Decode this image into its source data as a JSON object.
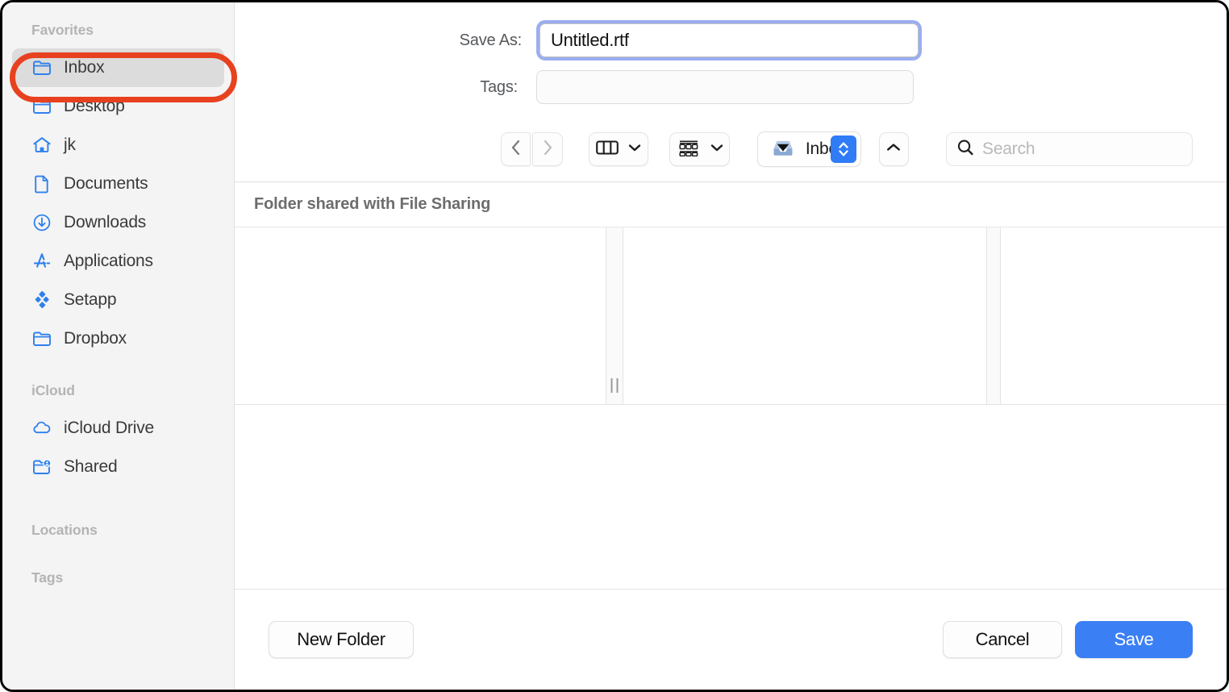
{
  "dialog": {
    "type": "macos-save-dialog"
  },
  "sidebar": {
    "sections": [
      {
        "title": "Favorites"
      },
      {
        "title": "iCloud"
      },
      {
        "title": "Locations"
      },
      {
        "title": "Tags"
      }
    ],
    "favorites": [
      {
        "label": "Inbox",
        "icon": "folder-icon",
        "selected": true
      },
      {
        "label": "Desktop",
        "icon": "folder-icon",
        "selected": false
      },
      {
        "label": "jk",
        "icon": "home-icon",
        "selected": false
      },
      {
        "label": "Documents",
        "icon": "document-icon",
        "selected": false
      },
      {
        "label": "Downloads",
        "icon": "download-icon",
        "selected": false
      },
      {
        "label": "Applications",
        "icon": "app-store-icon",
        "selected": false
      },
      {
        "label": "Setapp",
        "icon": "setapp-icon",
        "selected": false
      },
      {
        "label": "Dropbox",
        "icon": "folder-icon",
        "selected": false
      }
    ],
    "icloud": [
      {
        "label": "iCloud Drive",
        "icon": "cloud-icon",
        "selected": false
      },
      {
        "label": "Shared",
        "icon": "shared-folder-icon",
        "selected": false
      }
    ]
  },
  "form": {
    "save_as_label": "Save As:",
    "save_as_value": "Untitled.rtf",
    "tags_label": "Tags:",
    "tags_value": "",
    "tags_placeholder": ""
  },
  "toolbar": {
    "back_icon": "chevron-left-icon",
    "forward_icon": "chevron-right-icon",
    "view_column_icon": "column-view-icon",
    "view_column_chevron": "chevron-down-icon",
    "group_icon": "group-by-icon",
    "group_chevron": "chevron-down-icon",
    "path_icon": "inbox-tray-icon",
    "path_label": "Inbox",
    "stepper_icon": "up-down-stepper-icon",
    "up_icon": "chevron-up-icon",
    "search_icon": "search-icon",
    "search_value": "",
    "search_placeholder": "Search"
  },
  "content": {
    "shared_banner": "Folder shared with File Sharing",
    "columns": [
      {
        "items": []
      },
      {
        "items": []
      },
      {
        "items": []
      }
    ]
  },
  "footer": {
    "new_folder_label": "New Folder",
    "cancel_label": "Cancel",
    "save_label": "Save"
  },
  "annotation": {
    "shape": "ellipse",
    "target": "sidebar-item-inbox",
    "color": "#e8411f"
  },
  "colors": {
    "accent": "#3b7ff5",
    "stepper_blue": "#2f7cf6",
    "icon_blue": "#2f80ed",
    "sidebar_bg": "#f4f4f4",
    "selection_bg": "#dcdcdc",
    "focus_ring": "#9aaef0",
    "annotation_red": "#e8411f"
  }
}
